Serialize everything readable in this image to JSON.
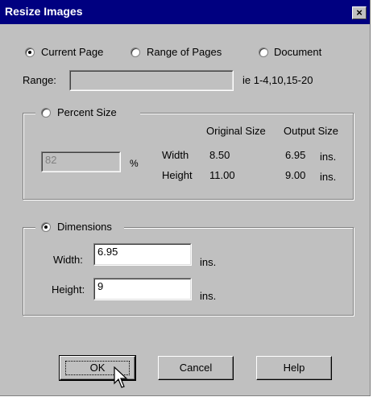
{
  "window": {
    "title": "Resize Images",
    "close_label": "×"
  },
  "scope": {
    "options": [
      "Current Page",
      "Range of Pages",
      "Document"
    ],
    "selected": "Current Page",
    "range_label": "Range:",
    "range_value": "",
    "range_hint": "ie 1-4,10,15-20"
  },
  "percent": {
    "label": "Percent Size",
    "selected": false,
    "value": "82",
    "unit": "%",
    "col_original": "Original Size",
    "col_output": "Output Size",
    "rows": [
      {
        "label": "Width",
        "original": "8.50",
        "output": "6.95",
        "unit": "ins."
      },
      {
        "label": "Height",
        "original": "11.00",
        "output": "9.00",
        "unit": "ins."
      }
    ]
  },
  "dimensions": {
    "label": "Dimensions",
    "selected": true,
    "width_label": "Width:",
    "width_value": "6.95",
    "width_unit": "ins.",
    "height_label": "Height:",
    "height_value": "9",
    "height_unit": "ins."
  },
  "buttons": {
    "ok": "OK",
    "cancel": "Cancel",
    "help": "Help"
  },
  "colors": {
    "face": "#c0c0c0",
    "titlebar": "#000080",
    "disabled_text": "#808080"
  },
  "icons": {
    "close": "close-icon",
    "cursor": "arrow-cursor-icon"
  }
}
